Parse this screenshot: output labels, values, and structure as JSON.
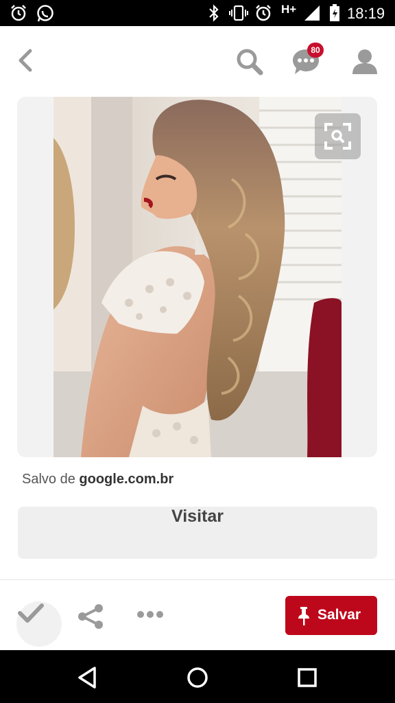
{
  "status_bar": {
    "time": "18:19",
    "network_type": "H+",
    "icons": [
      "alarm-icon",
      "whatsapp-icon",
      "bluetooth-icon",
      "vibrate-icon",
      "alarm-icon",
      "signal-icon",
      "battery-icon"
    ]
  },
  "header": {
    "back_icon": "chevron-left-icon",
    "search_icon": "search-icon",
    "messages_icon": "chat-bubble-icon",
    "notification_count": "80",
    "profile_icon": "person-icon"
  },
  "pin": {
    "image_description_icon": "photo",
    "visual_search_icon": "visual-search-icon",
    "saved_from_prefix": "Salvo de",
    "saved_from_domain": "google.com.br"
  },
  "visit_button": {
    "label": "Visitar"
  },
  "actions": {
    "done_icon": "check-icon",
    "share_icon": "share-icon",
    "more_icon": "more-dots-icon",
    "save_label": "Salvar",
    "save_icon": "pin-icon"
  },
  "colors": {
    "accent": "#bd081c",
    "badge": "#c8102e",
    "button_bg": "#efefef"
  },
  "nav_bar": {
    "back": "triangle-back-icon",
    "home": "circle-home-icon",
    "recents": "square-recents-icon"
  }
}
